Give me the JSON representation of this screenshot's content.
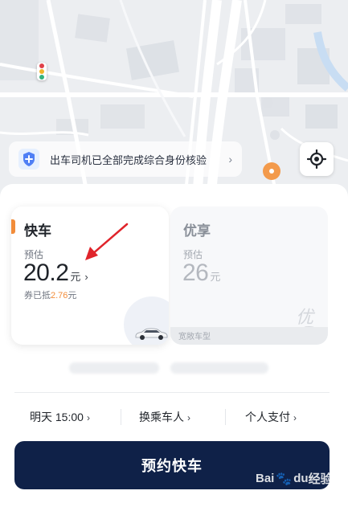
{
  "map": {
    "notice_text": "出车司机已全部完成综合身份核验",
    "notice_arrow": "›"
  },
  "cards": [
    {
      "name": "快车",
      "estimate_label": "预估",
      "price": "20.2",
      "unit": "元",
      "chevron": "›",
      "coupon_prefix": "券已抵",
      "coupon_amount": "2.76",
      "coupon_unit": "元",
      "selected": true
    },
    {
      "name": "优享",
      "estimate_label": "预估",
      "price": "26",
      "unit": "元",
      "model_label": "宽敞车型",
      "logo": "优",
      "selected": false
    }
  ],
  "options": [
    {
      "label": "明天 15:00",
      "chevron": "›"
    },
    {
      "label": "换乘车人",
      "chevron": "›"
    },
    {
      "label": "个人支付",
      "chevron": "›"
    }
  ],
  "cta_label": "预约快车",
  "watermark": {
    "brand": "Bai",
    "brand2": "du",
    "paw": "🐾",
    "suffix": "经验"
  },
  "colors": {
    "primary_button": "#0f2148",
    "accent_orange": "#f28c3a",
    "annotation_arrow": "#e0242b"
  },
  "icons": [
    "shield-plus-icon",
    "locate-icon",
    "traffic-light-icon",
    "map-pin-icon",
    "car-icon"
  ]
}
